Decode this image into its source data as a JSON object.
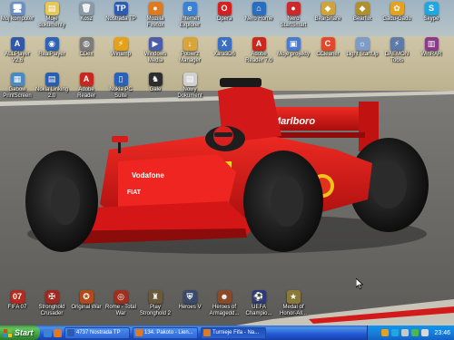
{
  "desktop_icons": [
    {
      "id": "my-computer",
      "label": "Mój komputer",
      "glyph": "🖥",
      "color": "#6a8fc7"
    },
    {
      "id": "my-documents",
      "label": "Moje dokumenty",
      "glyph": "▤",
      "color": "#e6c85a"
    },
    {
      "id": "recycle-bin",
      "label": "Kosz",
      "glyph": "🗑",
      "color": "#8a9aa8"
    },
    {
      "id": "nostrada",
      "label": "Nostrada TP",
      "glyph": "TP",
      "color": "#2c5bb0"
    },
    {
      "id": "firefox",
      "label": "Mozilla Firefox",
      "glyph": "●",
      "color": "#e07a20"
    },
    {
      "id": "ie",
      "label": "Internet Explorer",
      "glyph": "e",
      "color": "#3b82d6"
    },
    {
      "id": "opera",
      "label": "Opera",
      "glyph": "O",
      "color": "#d32020"
    },
    {
      "id": "nero-home",
      "label": "Nero Home",
      "glyph": "⌂",
      "color": "#2a6fbf"
    },
    {
      "id": "nero-startsmart",
      "label": "Nero StartSmart",
      "glyph": "●",
      "color": "#cc2a2a"
    },
    {
      "id": "bearshare",
      "label": "BearShare",
      "glyph": "◆",
      "color": "#cfa43a"
    },
    {
      "id": "bearflix",
      "label": "Bearflix",
      "glyph": "◆",
      "color": "#b0902e"
    },
    {
      "id": "gadu-gadu",
      "label": "Gadu-Gadu",
      "glyph": "✿",
      "color": "#e6a21f"
    },
    {
      "id": "skype",
      "label": "Skype",
      "glyph": "S",
      "color": "#1ea7e1"
    },
    {
      "id": "alltoplayer",
      "label": "ALLPlayer V2.6",
      "glyph": "A",
      "color": "#3057a8"
    },
    {
      "id": "realplayer",
      "label": "RealPlayer",
      "glyph": "◉",
      "color": "#2c63b5"
    },
    {
      "id": "cdex",
      "label": "CDex",
      "glyph": "◍",
      "color": "#7c7c7c"
    },
    {
      "id": "winamp",
      "label": "Winamp",
      "glyph": "⚡",
      "color": "#e3a11c"
    },
    {
      "id": "windows-media",
      "label": "Windows Media",
      "glyph": "▶",
      "color": "#4a5da8"
    },
    {
      "id": "pobierz-manager",
      "label": "Pobierz Manager",
      "glyph": "↓",
      "color": "#d8a43c"
    },
    {
      "id": "xara3d",
      "label": "Xara3D6",
      "glyph": "X",
      "color": "#3a6fc3"
    },
    {
      "id": "adobe-reader",
      "label": "Adobe Reader 7.0",
      "glyph": "A",
      "color": "#c8281f"
    },
    {
      "id": "moje-projekty",
      "label": "Moje projekty",
      "glyph": "▣",
      "color": "#4a7ad0"
    },
    {
      "id": "ccleaner",
      "label": "CCleaner",
      "glyph": "C",
      "color": "#e2482c"
    },
    {
      "id": "light-startup",
      "label": "Light StartUp",
      "glyph": "☼",
      "color": "#7e9cc8"
    },
    {
      "id": "daemon-tools",
      "label": "DAEMON Tools",
      "glyph": "⚡",
      "color": "#5e7aa8"
    },
    {
      "id": "winrar",
      "label": "WinRAR",
      "glyph": "▥",
      "color": "#8a3a8a"
    },
    {
      "id": "gabow-printscreen",
      "label": "Gabow PrintScreen",
      "glyph": "▦",
      "color": "#4a8ac2"
    },
    {
      "id": "nokia-linking",
      "label": "Nokia Linking 2.0",
      "glyph": "▤",
      "color": "#2a5fb0"
    },
    {
      "id": "adobe-reader-2",
      "label": "Adobe Reader",
      "glyph": "A",
      "color": "#c8281f"
    },
    {
      "id": "nokia-pc-suite",
      "label": "Nokia PC Suite",
      "glyph": "▯",
      "color": "#2a62b8"
    },
    {
      "id": "gale",
      "label": "Gale",
      "glyph": "♞",
      "color": "#2e2e2e"
    },
    {
      "id": "nowy-dokument",
      "label": "Nowy Dokument",
      "glyph": "▤",
      "color": "#d0d0d0"
    }
  ],
  "game_icons": [
    {
      "id": "fifa07",
      "label": "FIFA 07",
      "glyph": "07",
      "color": "#b42a1e"
    },
    {
      "id": "stronghold-crusader",
      "label": "Stronghold Crusader",
      "glyph": "✠",
      "color": "#9c2a22"
    },
    {
      "id": "original-war",
      "label": "Original War",
      "glyph": "✪",
      "color": "#b24a1a"
    },
    {
      "id": "rome-total-war",
      "label": "Rome - Total War",
      "glyph": "◎",
      "color": "#a0301e"
    },
    {
      "id": "play-stronghold-2",
      "label": "Play Stronghold 2",
      "glyph": "♜",
      "color": "#6a5a3a"
    },
    {
      "id": "heroes-v",
      "label": "Heroes V",
      "glyph": "⛨",
      "color": "#3a4a6a"
    },
    {
      "id": "heroes-armageddon",
      "label": "Heroes of Armagedd...",
      "glyph": "☻",
      "color": "#8a4a2a"
    },
    {
      "id": "uefa-champions",
      "label": "UEFA Champio...",
      "glyph": "⚽",
      "color": "#2a3a7a"
    },
    {
      "id": "medal-of-honor",
      "label": "Medal of Honor-All...",
      "glyph": "★",
      "color": "#8a7a3a"
    }
  ],
  "taskbar": {
    "start_label": "Start",
    "tasks": [
      {
        "id": "task-nostrada",
        "label": "4737 Nostrada TP",
        "color": "#2c5bb0",
        "active": false
      },
      {
        "id": "task-pakoto",
        "label": "134. Pakoto - Lien...",
        "color": "#e07a20",
        "active": false
      },
      {
        "id": "task-turnieje",
        "label": "Turnieje Fifa - Na...",
        "color": "#e07a20",
        "active": true
      }
    ],
    "clock": "23:46"
  },
  "colors": {
    "asphalt": "#6f6e6b",
    "car_red": "#d41414",
    "sky": "#b9c6cf"
  }
}
